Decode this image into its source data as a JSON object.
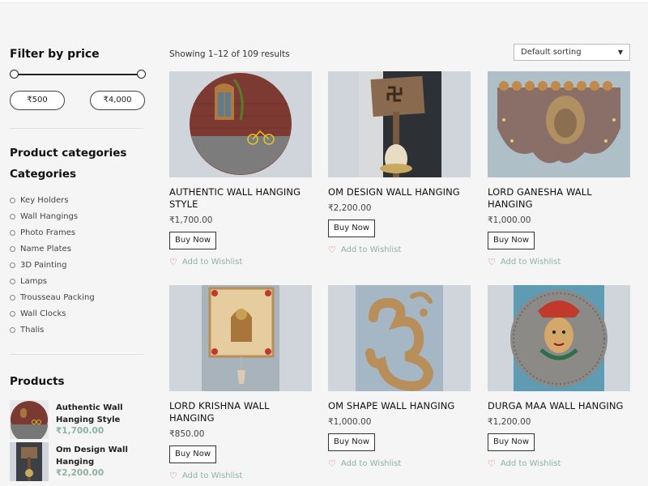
{
  "sidebar": {
    "filter_title": "Filter by price",
    "price_min": "₹500",
    "price_max": "₹4,000",
    "product_categories_title": "Product categories",
    "categories_title": "Categories",
    "categories": [
      "Key Holders",
      "Wall Hangings",
      "Photo Frames",
      "Name Plates",
      "3D Painting",
      "Lamps",
      "Trousseau Packing",
      "Wall Clocks",
      "Thalis"
    ],
    "products_title": "Products",
    "products": [
      {
        "name": "Authentic Wall Hanging Style",
        "price": "₹1,700.00"
      },
      {
        "name": "Om Design Wall Hanging",
        "price": "₹2,200.00"
      }
    ]
  },
  "main": {
    "results_text": "Showing 1–12 of 109 results",
    "sort_selected": "Default sorting",
    "buy_label": "Buy Now",
    "wishlist_label": "Add to Wishlist",
    "products": [
      {
        "title": "AUTHENTIC WALL HANGING STYLE",
        "price": "₹1,700.00",
        "image_icon": "brick-window-bicycle-plate"
      },
      {
        "title": "OM DESIGN WALL HANGING",
        "price": "₹2,200.00",
        "image_icon": "swastik-ganesha-stand"
      },
      {
        "title": "LORD GANESHA WALL HANGING",
        "price": "₹1,000.00",
        "image_icon": "ganesha-plaque"
      },
      {
        "title": "LORD KRISHNA WALL HANGING",
        "price": "₹850.00",
        "image_icon": "krishna-frame"
      },
      {
        "title": "OM SHAPE WALL HANGING",
        "price": "₹1,000.00",
        "image_icon": "om-shape"
      },
      {
        "title": "DURGA MAA WALL HANGING",
        "price": "₹1,200.00",
        "image_icon": "durga-face-plate"
      }
    ]
  },
  "colors": {
    "accent": "#8bb3a2",
    "heart": "#e05a5a",
    "image_bg": "#cfd5da"
  }
}
